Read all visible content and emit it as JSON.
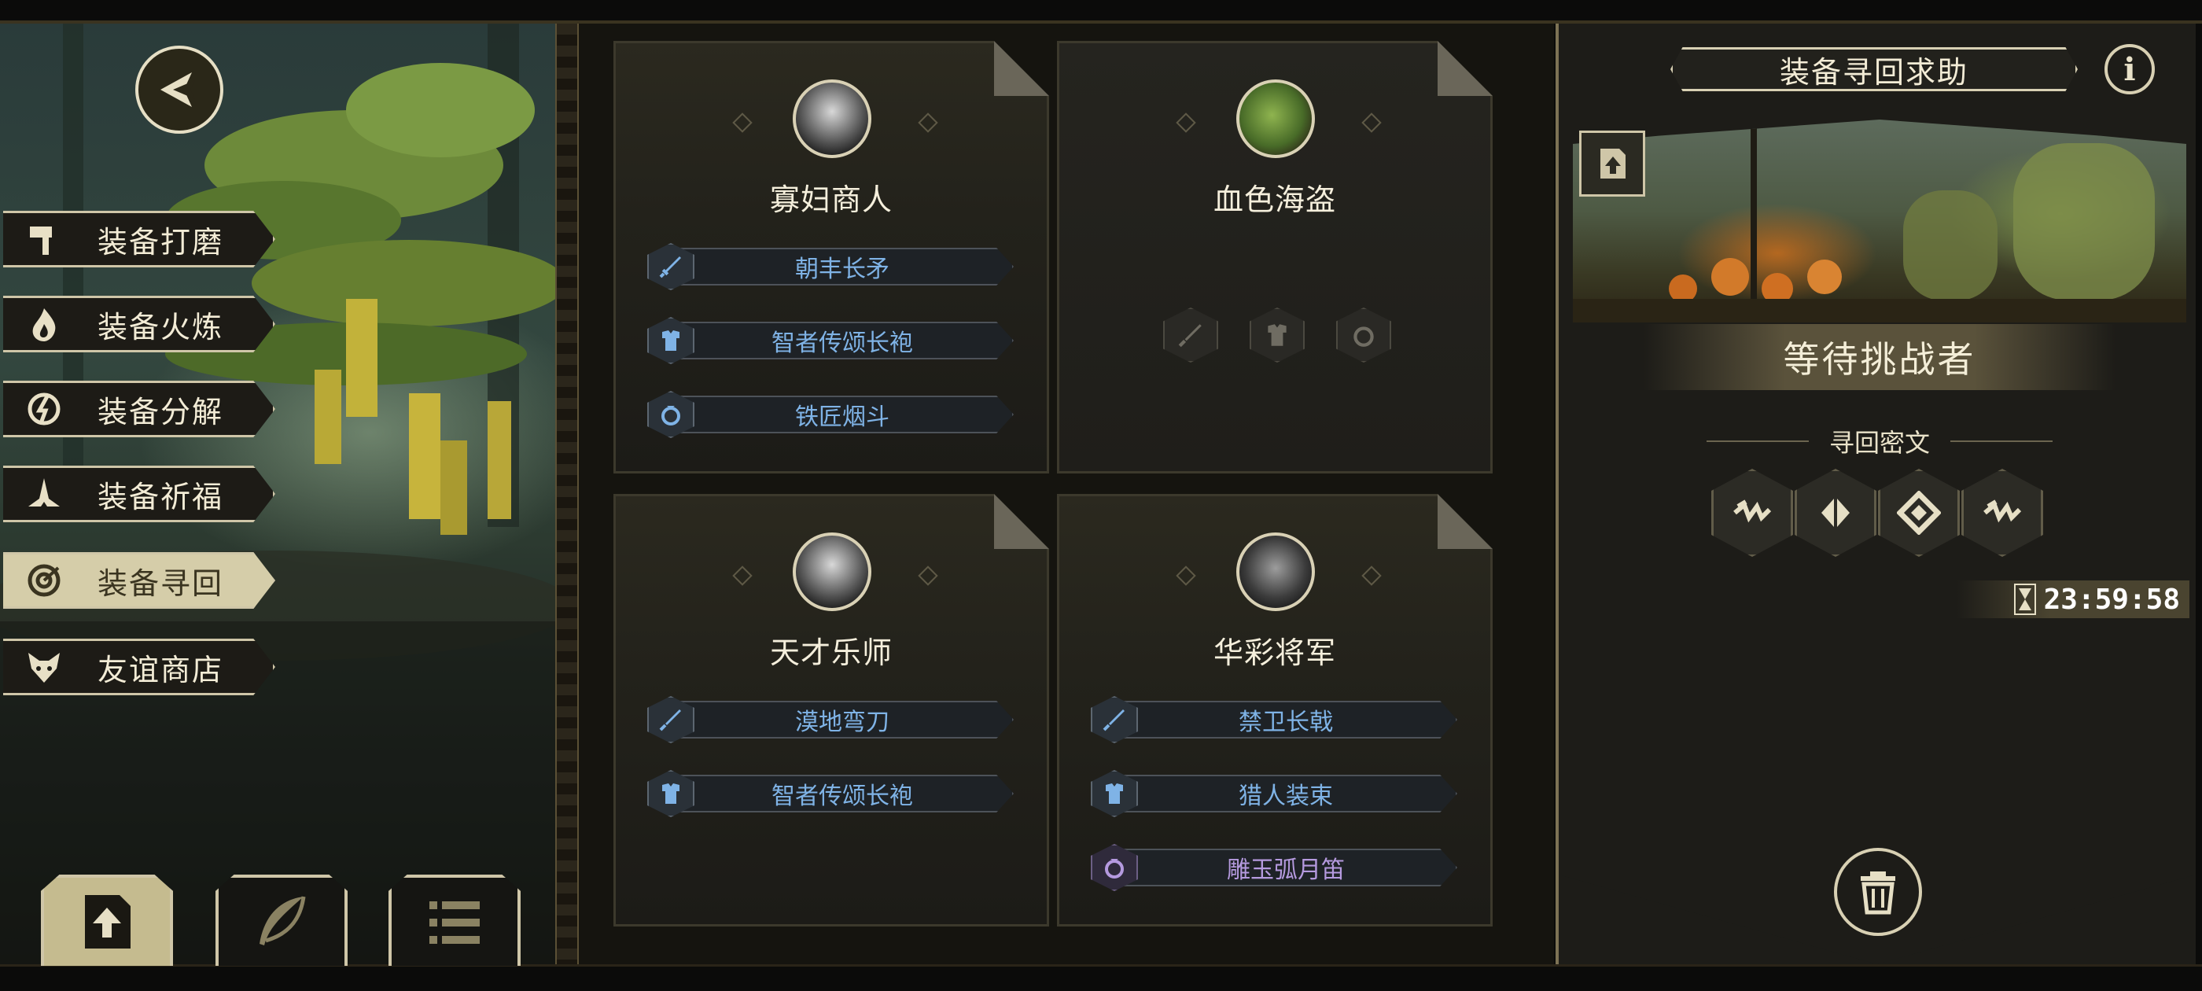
{
  "left_menu": {
    "items": [
      {
        "label": "装备打磨",
        "icon": "hammer-icon",
        "active": false
      },
      {
        "label": "装备火炼",
        "icon": "flame-icon",
        "active": false
      },
      {
        "label": "装备分解",
        "icon": "disassemble-icon",
        "active": false
      },
      {
        "label": "装备祈福",
        "icon": "praying-hands-icon",
        "active": false
      },
      {
        "label": "装备寻回",
        "icon": "target-icon",
        "active": true
      },
      {
        "label": "友谊商店",
        "icon": "fox-icon",
        "active": false
      }
    ],
    "bottom_buttons": [
      {
        "icon": "upload-icon",
        "active": true
      },
      {
        "icon": "feather-icon",
        "active": false
      },
      {
        "icon": "list-icon",
        "active": false
      }
    ]
  },
  "cards": [
    {
      "name": "寡妇商人",
      "items": [
        {
          "label": "朝丰长矛",
          "type": "weapon",
          "rarity": "blue"
        },
        {
          "label": "智者传颂长袍",
          "type": "armor",
          "rarity": "blue"
        },
        {
          "label": "铁匠烟斗",
          "type": "ring",
          "rarity": "blue"
        }
      ]
    },
    {
      "name": "血色海盗",
      "items": []
    },
    {
      "name": "天才乐师",
      "items": [
        {
          "label": "漠地弯刀",
          "type": "weapon",
          "rarity": "blue"
        },
        {
          "label": "智者传颂长袍",
          "type": "armor",
          "rarity": "blue"
        }
      ]
    },
    {
      "name": "华彩将军",
      "items": [
        {
          "label": "禁卫长戟",
          "type": "weapon",
          "rarity": "blue"
        },
        {
          "label": "猎人装束",
          "type": "armor",
          "rarity": "blue"
        },
        {
          "label": "雕玉弧月笛",
          "type": "ring",
          "rarity": "purple"
        }
      ]
    }
  ],
  "right_panel": {
    "title": "装备寻回求助",
    "info_icon": "i",
    "status": "等待挑战者",
    "cipher_label": "寻回密文",
    "runes": [
      "rune-zigzag-icon",
      "rune-split-icon",
      "rune-diamond-icon",
      "rune-zigzag-icon"
    ],
    "timer": "23:59:58"
  },
  "colors": {
    "blue_item": "#7fb3e6",
    "purple_item": "#b59adf",
    "gold_trim": "#d8d0b3"
  }
}
